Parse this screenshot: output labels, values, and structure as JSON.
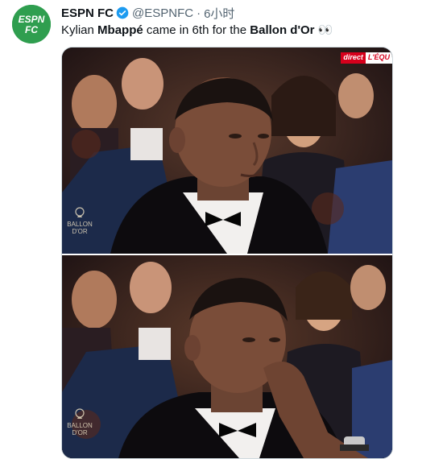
{
  "account": {
    "avatar_text": "ESPN FC",
    "name": "ESPN FC",
    "handle": "@ESPNFC",
    "separator": "·",
    "time": "6小时"
  },
  "tweet": {
    "text_1": "Kylian ",
    "text_bold_1": "Mbappé",
    "text_2": " came in 6th for the ",
    "text_bold_2": "Ballon d'Or",
    "emoji": "👀"
  },
  "media": {
    "badge_left": "direct",
    "badge_right": "L'ÉQU",
    "watermark_top": "BALLON D'OR",
    "watermark_bottom": "BALLON D'OR"
  },
  "colors": {
    "brand": "#2f9e4f",
    "verified": "#1d9bf0",
    "muted": "#536471"
  },
  "icons": [
    "espn-fc-logo-icon",
    "verified-badge-icon",
    "ballon-dor-trophy-icon"
  ]
}
